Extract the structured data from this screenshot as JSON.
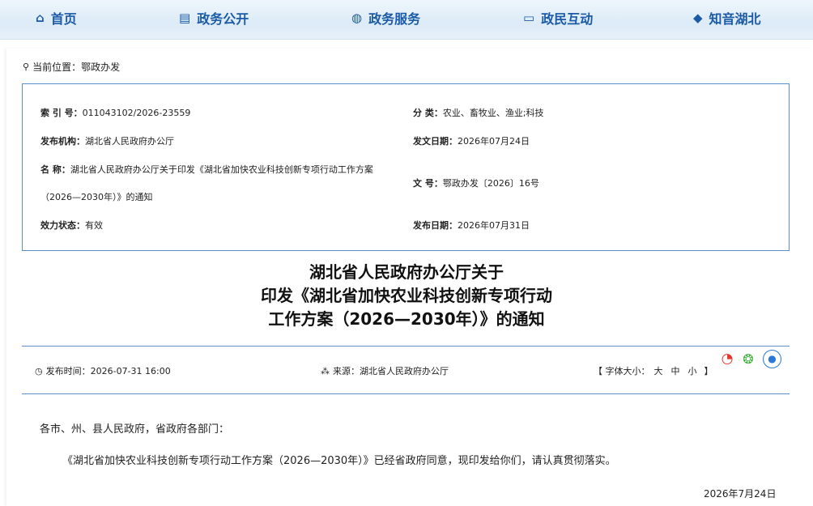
{
  "nav": {
    "items": [
      {
        "label": "首页",
        "icon": "home-icon",
        "glyph": "⌂"
      },
      {
        "label": "政务公开",
        "icon": "document-icon",
        "glyph": "▤"
      },
      {
        "label": "政务服务",
        "icon": "service-icon",
        "glyph": "◍"
      },
      {
        "label": "政民互动",
        "icon": "chat-icon",
        "glyph": "▭"
      },
      {
        "label": "知音湖北",
        "icon": "hubei-map-icon",
        "glyph": "◆"
      }
    ]
  },
  "breadcrumb": {
    "prefix": "当前位置：",
    "current": "鄂政办发"
  },
  "info": {
    "index_label": "索 引 号：",
    "index_value": "011043102/2026-23559",
    "category_label": "分 类：",
    "category_value": "农业、畜牧业、渔业;科技",
    "issuer_label": "发布机构：",
    "issuer_value": "湖北省人民政府办公厅",
    "doc_date_label": "发文日期：",
    "doc_date_value": "2026年07月24日",
    "name_label": "名 称：",
    "name_value_line1": "湖北省人民政府办公厅关于印发《湖北省加快农业科技创新专项行动工作方案",
    "name_value_line2": "（2026—2030年）》的通知",
    "doc_no_label": "文 号：",
    "doc_no_value": "鄂政办发〔2026〕16号",
    "status_label": "效力状态：",
    "status_value": "有效",
    "pub_date_label": "发布日期：",
    "pub_date_value": "2026年07月31日"
  },
  "title": {
    "line1": "湖北省人民政府办公厅关于",
    "line2": "印发《湖北省加快农业科技创新专项行动",
    "line3": "工作方案（2026—2030年）》的通知"
  },
  "meta": {
    "time_label": "发布时间：",
    "time_value": "2026-07-31 16:00",
    "source_label": "来源：",
    "source_value": "湖北省人民政府办公厅",
    "font_label": "【 字体大小：",
    "font_large": "大",
    "font_medium": "中",
    "font_small": "小",
    "font_close": "】"
  },
  "body": {
    "salutation": "各市、州、县人民政府，省政府各部门：",
    "para1": "《湖北省加快农业科技创新专项行动工作方案（2026—2030年）》已经省政府同意，现印发给你们，请认真贯彻落实。",
    "date": "2026年7月24日"
  }
}
